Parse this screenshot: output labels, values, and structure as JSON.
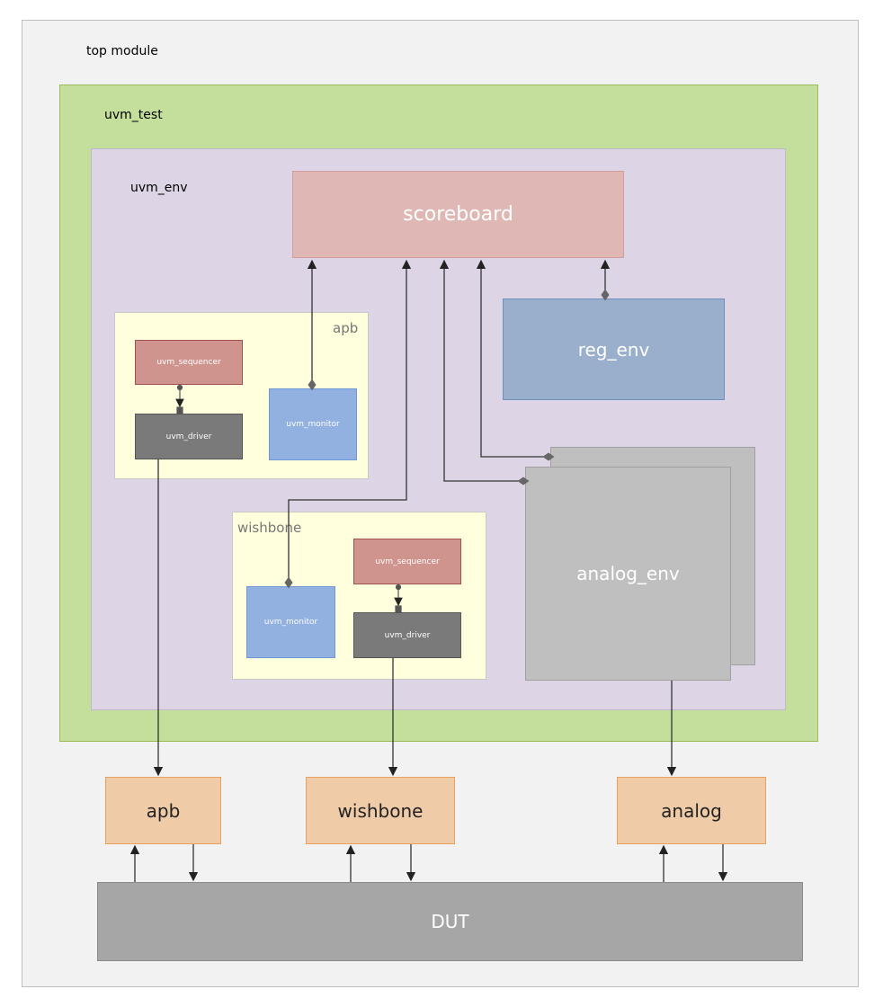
{
  "top_module": {
    "label": "top module"
  },
  "uvm_test": {
    "label": "uvm_test"
  },
  "uvm_env": {
    "label": "uvm_env"
  },
  "scoreboard": {
    "label": "scoreboard"
  },
  "reg_env": {
    "label": "reg_env"
  },
  "apb_agent": {
    "label": "apb",
    "sequencer": "uvm_sequencer",
    "driver": "uvm_driver",
    "monitor": "uvm_monitor"
  },
  "wishbone_agent": {
    "label": "wishbone",
    "sequencer": "uvm_sequencer",
    "driver": "uvm_driver",
    "monitor": "uvm_monitor"
  },
  "analog_env": {
    "label": "analog_env"
  },
  "interfaces": {
    "apb": "apb",
    "wishbone": "wishbone",
    "analog": "analog"
  },
  "dut": {
    "label": "DUT"
  },
  "colors": {
    "uvm_test": "#c3df9b",
    "uvm_env": "#ddd5e5",
    "scoreboard": "#dfb8b6",
    "reg_env": "#9aafcc",
    "agent": "#ffffdd",
    "sequencer": "#d0948f",
    "driver": "#7a7a7a",
    "monitor": "#92b0e0",
    "analog_env": "#bfbfbf",
    "interface": "#f0cba8",
    "dut": "#a6a6a6"
  }
}
